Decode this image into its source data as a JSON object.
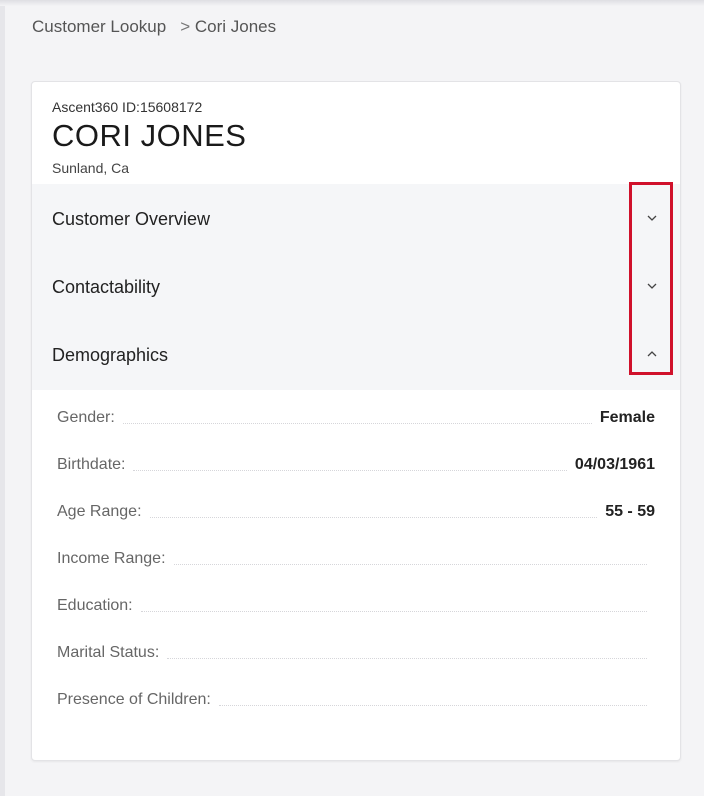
{
  "breadcrumb": {
    "root": "Customer Lookup",
    "separator": ">",
    "current": "Cori Jones"
  },
  "customer": {
    "id_line": "Ascent360 ID:15608172",
    "name": "CORI JONES",
    "location": "Sunland, Ca"
  },
  "sections": [
    {
      "title": "Customer Overview",
      "icon": "chevron-down-icon",
      "expanded": false
    },
    {
      "title": "Contactability",
      "icon": "chevron-down-icon",
      "expanded": false
    },
    {
      "title": "Demographics",
      "icon": "chevron-up-icon",
      "expanded": true
    }
  ],
  "demographics": [
    {
      "label": "Gender:",
      "value": "Female"
    },
    {
      "label": "Birthdate:",
      "value": "04/03/1961"
    },
    {
      "label": "Age Range:",
      "value": "55 - 59"
    },
    {
      "label": "Income Range:",
      "value": ""
    },
    {
      "label": "Education:",
      "value": ""
    },
    {
      "label": "Marital Status:",
      "value": ""
    },
    {
      "label": "Presence of Children:",
      "value": ""
    }
  ],
  "colors": {
    "highlight": "#d0112b",
    "section_background": "#f5f6f8"
  }
}
